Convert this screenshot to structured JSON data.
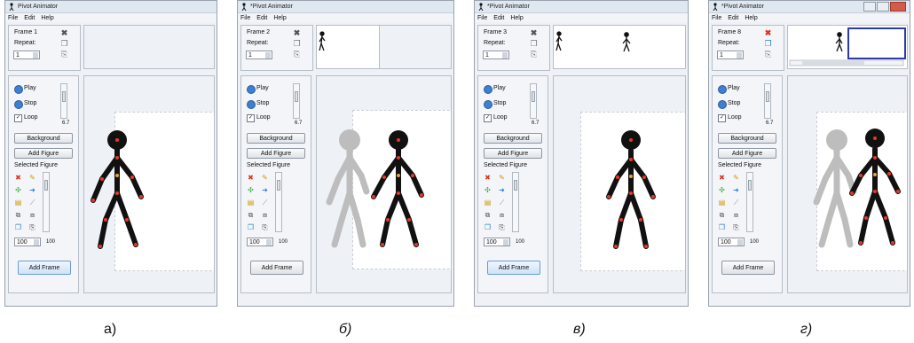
{
  "panels": [
    {
      "title": "Pivot Animator",
      "menu": [
        "File",
        "Edit",
        "Help"
      ],
      "frame_label": "Frame 1",
      "repeat_label": "Repeat:",
      "repeat_value": "1",
      "play_label": "Play",
      "stop_label": "Stop",
      "loop_label": "Loop",
      "speed_value": "6.7",
      "background_button": "Background",
      "add_figure_button": "Add Figure",
      "selected_figure_label": "Selected Figure",
      "size_value": "100",
      "size_max": "100",
      "add_frame_button": "Add Frame",
      "caption": "а)"
    },
    {
      "title": "*Pivot Animator",
      "menu": [
        "File",
        "Edit",
        "Help"
      ],
      "frame_label": "Frame 2",
      "repeat_label": "Repeat:",
      "repeat_value": "1",
      "play_label": "Play",
      "stop_label": "Stop",
      "loop_label": "Loop",
      "speed_value": "6.7",
      "background_button": "Background",
      "add_figure_button": "Add Figure",
      "selected_figure_label": "Selected Figure",
      "size_value": "100",
      "size_max": "100",
      "add_frame_button": "Add Frame",
      "caption": "б)"
    },
    {
      "title": "*Pivot Animator",
      "menu": [
        "File",
        "Edit",
        "Help"
      ],
      "frame_label": "Frame 3",
      "repeat_label": "Repeat:",
      "repeat_value": "1",
      "play_label": "Play",
      "stop_label": "Stop",
      "loop_label": "Loop",
      "speed_value": "6.7",
      "background_button": "Background",
      "add_figure_button": "Add Figure",
      "selected_figure_label": "Selected Figure",
      "size_value": "100",
      "size_max": "100",
      "add_frame_button": "Add Frame",
      "caption": "в)"
    },
    {
      "title": "*Pivot Animator",
      "menu": [
        "File",
        "Edit",
        "Help"
      ],
      "frame_label": "Frame 8",
      "repeat_label": "Repeat:",
      "repeat_value": "1",
      "play_label": "Play",
      "stop_label": "Stop",
      "loop_label": "Loop",
      "speed_value": "6.7",
      "background_button": "Background",
      "add_figure_button": "Add Figure",
      "selected_figure_label": "Selected Figure",
      "size_value": "100",
      "size_max": "100",
      "add_frame_button": "Add Frame",
      "caption": "г)"
    }
  ],
  "colors": {
    "figure": "#111111",
    "joint": "#e23a2a",
    "onion_skin": "#bdbdbd",
    "accent_blue": "#3d7fd0"
  }
}
